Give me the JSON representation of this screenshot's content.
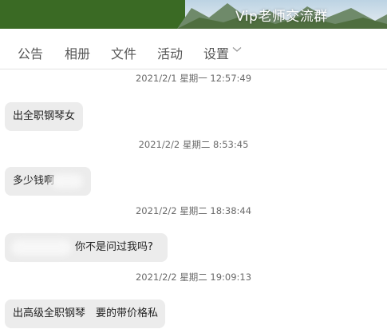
{
  "header": {
    "title": "Vip老师交流群"
  },
  "tabs": [
    {
      "label": "公告"
    },
    {
      "label": "相册"
    },
    {
      "label": "文件"
    },
    {
      "label": "活动"
    },
    {
      "label": "设置"
    }
  ],
  "icons": {
    "settings_dropdown": "chevron-down-icon"
  },
  "colors": {
    "header_green": "#3a6a24",
    "bubble_bg": "#ececec",
    "timestamp": "#6a6a6a"
  },
  "messages": [
    {
      "time": "2021/2/1 星期一 12:57:49",
      "text": "出全职钢琴女"
    },
    {
      "time": "2021/2/2 星期二 8:53:45",
      "text": "多少钱啊"
    },
    {
      "time": "2021/2/2 星期二 18:38:44",
      "text": "你不是问过我吗?"
    },
    {
      "time": "2021/2/2 星期二 19:09:13",
      "text": "出高级全职钢琴　要的带价格私"
    }
  ]
}
